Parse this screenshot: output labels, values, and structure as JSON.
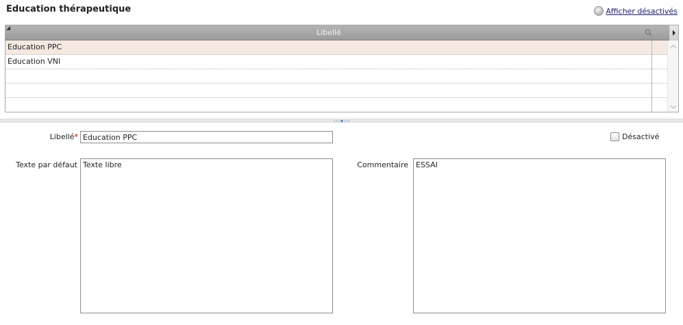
{
  "header": {
    "title": "Education thérapeutique",
    "show_disabled_label": "Afficher désactivés"
  },
  "grid": {
    "column_label": "Libellé",
    "rows": [
      "Education PPC",
      "Education VNI",
      "",
      "",
      ""
    ],
    "selected_index": 0
  },
  "form": {
    "libelle_label": "Libellé",
    "required_mark": "*",
    "libelle_value": "Education PPC",
    "disabled_label": "Désactivé",
    "texte_label": "Texte par défaut",
    "texte_value": "Texte libre",
    "commentaire_label": "Commentaire",
    "commentaire_value": "ESSAI"
  },
  "icons": {
    "grid_corner": "resize-corner-icon",
    "grid_search": "search-icon",
    "grid_menu": "column-menu-arrow-icon",
    "show_disabled": "radio-icon"
  },
  "colors": {
    "header_bg": "#a3a3a3",
    "selected_row": "#f4e9e2",
    "link": "#1a1a6b",
    "required": "#c00000"
  }
}
